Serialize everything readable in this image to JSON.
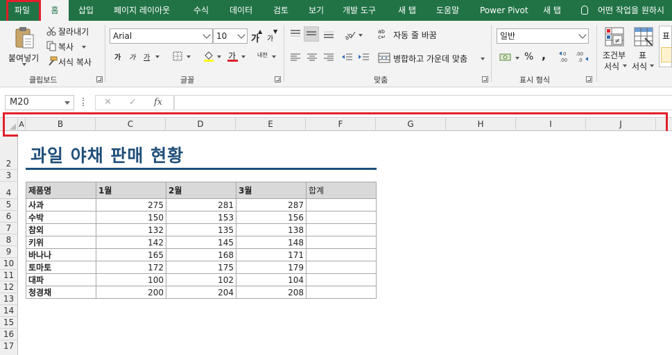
{
  "tabs": {
    "file": "파일",
    "items": [
      "홈",
      "삽입",
      "페이지 레이아웃",
      "수식",
      "데이터",
      "검토",
      "보기",
      "개발 도구",
      "새 탭",
      "도움말",
      "Power Pivot",
      "새 탭"
    ],
    "tell_me": "어떤 작업을 원하시"
  },
  "ribbon": {
    "clipboard": {
      "paste": "붙여넣기",
      "cut": "잘라내기",
      "copy": "복사",
      "format_painter": "서식 복사",
      "label": "클립보드"
    },
    "font": {
      "name": "Arial",
      "size": "10",
      "grow": "가",
      "shrink": "가",
      "bold": "가",
      "italic": "가",
      "underline": "가",
      "font_color": "가",
      "phonetic": "내천",
      "label": "글꼴"
    },
    "alignment": {
      "wrap_text": "자동 줄 바꿈",
      "merge_center": "병합하고 가운데 맞춤",
      "label": "맞춤"
    },
    "number": {
      "format": "일반",
      "percent": "%",
      "comma": ",",
      "label": "표시 형식"
    },
    "styles": {
      "conditional_line1": "조건부",
      "conditional_line2": "서식",
      "table_line1": "표",
      "table_line2": "서식",
      "cell_style_preview": "표"
    }
  },
  "formula_bar": {
    "name_box": "M20",
    "cancel": "✕",
    "enter": "✓",
    "fx": "fx",
    "value": ""
  },
  "columns": [
    "A",
    "B",
    "C",
    "D",
    "E",
    "F",
    "G",
    "H",
    "I",
    "J"
  ],
  "rows": [
    "2",
    "3",
    "4",
    "5",
    "6",
    "7",
    "8",
    "9",
    "10",
    "11",
    "12",
    "13",
    "14",
    "15",
    "16",
    "17"
  ],
  "sheet": {
    "title": "과일 야채 판매 현황",
    "headers": [
      "제품명",
      "1월",
      "2월",
      "3월",
      "합계"
    ],
    "products": [
      {
        "name": "사과",
        "m1": "275",
        "m2": "281",
        "m3": "287",
        "total": ""
      },
      {
        "name": "수박",
        "m1": "150",
        "m2": "153",
        "m3": "156",
        "total": ""
      },
      {
        "name": "참외",
        "m1": "132",
        "m2": "135",
        "m3": "138",
        "total": ""
      },
      {
        "name": "키위",
        "m1": "142",
        "m2": "145",
        "m3": "148",
        "total": ""
      },
      {
        "name": "바나나",
        "m1": "165",
        "m2": "168",
        "m3": "171",
        "total": ""
      },
      {
        "name": "토마토",
        "m1": "172",
        "m2": "175",
        "m3": "179",
        "total": ""
      },
      {
        "name": "대파",
        "m1": "100",
        "m2": "102",
        "m3": "104",
        "total": ""
      },
      {
        "name": "청경채",
        "m1": "200",
        "m2": "204",
        "m3": "208",
        "total": ""
      }
    ]
  },
  "colors": {
    "accent": "#217346",
    "title": "#1f4e79",
    "highlight": "#e0202a"
  }
}
